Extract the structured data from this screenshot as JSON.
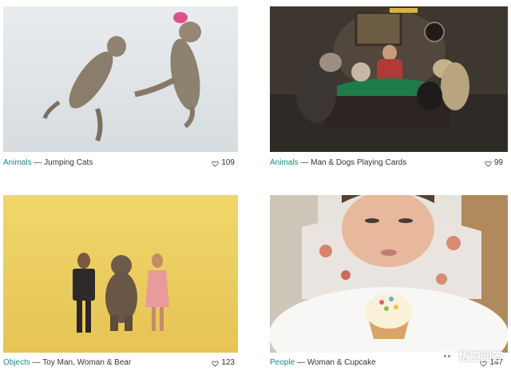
{
  "cards": [
    {
      "category": "Animals",
      "separator": " — ",
      "title": "Jumping Cats",
      "likes": "109",
      "image": "jumping-cats-photo"
    },
    {
      "category": "Animals",
      "separator": " — ",
      "title": "Man & Dogs Playing Cards",
      "likes": "99",
      "image": "dogs-poker-photo"
    },
    {
      "category": "Objects",
      "separator": " — ",
      "title": "Toy Man, Woman & Bear",
      "likes": "123",
      "image": "wooden-figures-photo"
    },
    {
      "category": "People",
      "separator": " — ",
      "title": "Woman & Cupcake",
      "likes": "147",
      "image": "woman-cupcake-photo"
    }
  ],
  "watermark": {
    "text": "悟空问答"
  },
  "colors": {
    "category_link": "#1a8a8a",
    "text": "#333333"
  },
  "icons": {
    "like": "heart-outline-icon",
    "watermark": "chat-bubble-icon"
  }
}
